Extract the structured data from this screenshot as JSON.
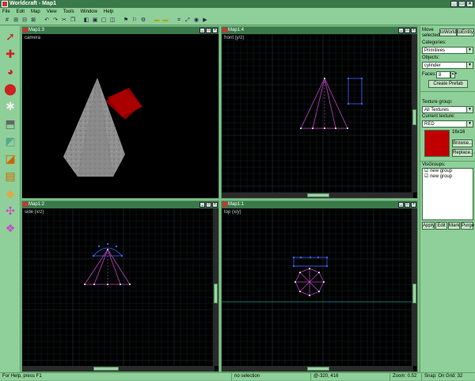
{
  "window": {
    "title": "Worldcraft - Map1"
  },
  "menu": [
    "File",
    "Edit",
    "Map",
    "View",
    "Tools",
    "Window",
    "Help"
  ],
  "viewports": {
    "camera": {
      "title": "Map1:3",
      "label": "camera"
    },
    "front": {
      "title": "Map1:4",
      "label": "front (y/z)"
    },
    "side": {
      "title": "Map1:2",
      "label": "side (x/z)"
    },
    "top": {
      "title": "Map1:1",
      "label": "top (x/y)"
    }
  },
  "panel": {
    "move_selected_label": "Move selected:",
    "to_world": "toWorld",
    "to_entity": "toEntity",
    "categories_label": "Categories:",
    "categories_value": "Primitives",
    "objects_label": "Objects:",
    "objects_value": "cylinder",
    "faces_label": "Faces:",
    "faces_value": "8",
    "create_prefab": "Create Prefab",
    "texture_group_label": "Texture group:",
    "texture_group_value": "All Textures",
    "current_texture_label": "Current texture:",
    "current_texture_value": "RED",
    "texture_size": "16x16",
    "browse": "Browse...",
    "replace": "Replace...",
    "texture_color": "#c00000",
    "visgroups_label": "VisGroups:",
    "visgroups": [
      "new group",
      "new group"
    ],
    "apply": "Apply",
    "edit": "Edit",
    "mark": "Mark",
    "purge": "Purge"
  },
  "status": {
    "help": "For Help, press F1",
    "selection": "no selection",
    "coords": "@-320, 416",
    "zoom": "Zoom: 0.52",
    "snap": "Snap: On Grid: 32"
  },
  "colors": {
    "brush": "#c040c0",
    "vertex": "#4060ff",
    "grid": "#1e3a3a",
    "axis": "#1e6e6e"
  }
}
